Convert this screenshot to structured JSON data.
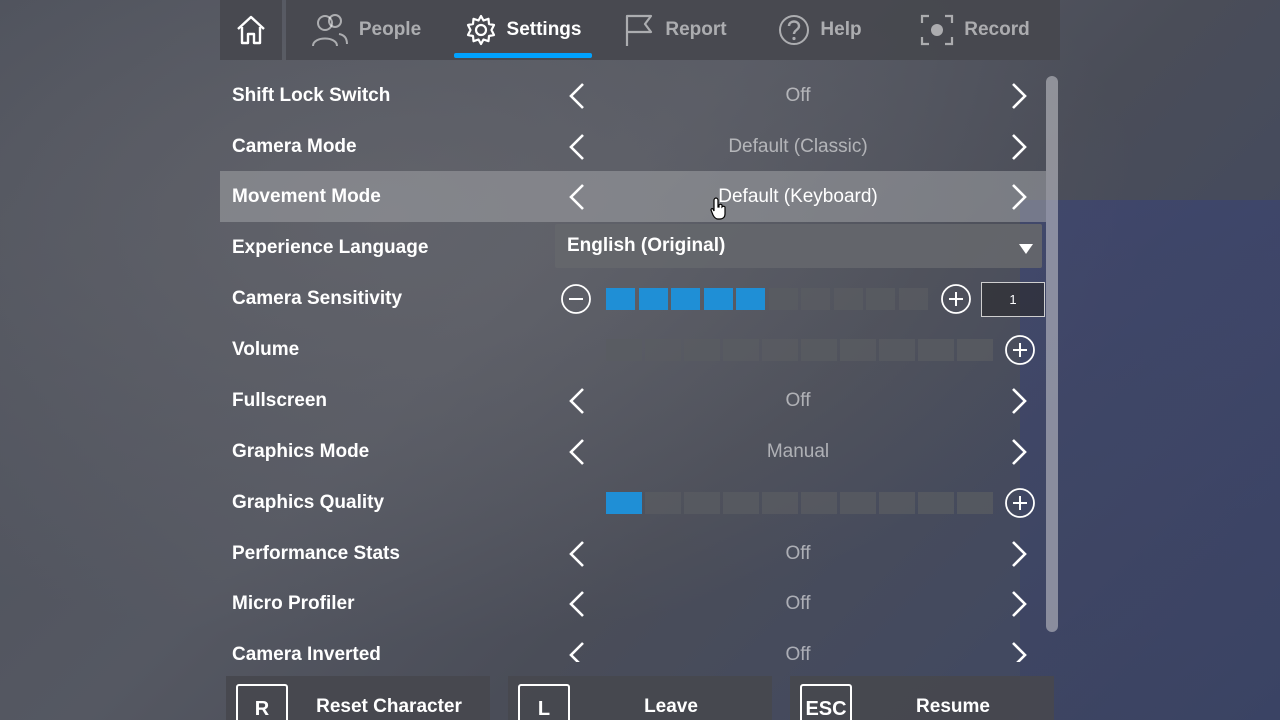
{
  "tabs": {
    "home": {
      "icon": "home-icon"
    },
    "items": [
      {
        "label": "People",
        "icon": "people-icon",
        "active": false
      },
      {
        "label": "Settings",
        "icon": "gear-icon",
        "active": true
      },
      {
        "label": "Report",
        "icon": "flag-icon",
        "active": false
      },
      {
        "label": "Help",
        "icon": "help-icon",
        "active": false
      },
      {
        "label": "Record",
        "icon": "record-icon",
        "active": false
      }
    ]
  },
  "settings": {
    "shift_lock": {
      "label": "Shift Lock Switch",
      "value": "Off"
    },
    "camera_mode": {
      "label": "Camera Mode",
      "value": "Default (Classic)"
    },
    "movement_mode": {
      "label": "Movement Mode",
      "value": "Default (Keyboard)"
    },
    "language": {
      "label": "Experience Language",
      "value": "English (Original)"
    },
    "camera_sensitivity": {
      "label": "Camera Sensitivity",
      "filled": 5,
      "total": 10,
      "value": "1"
    },
    "volume": {
      "label": "Volume",
      "filled": 0,
      "total": 10
    },
    "fullscreen": {
      "label": "Fullscreen",
      "value": "Off"
    },
    "graphics_mode": {
      "label": "Graphics Mode",
      "value": "Manual"
    },
    "graphics_quality": {
      "label": "Graphics Quality",
      "filled": 1,
      "total": 10
    },
    "performance_stats": {
      "label": "Performance Stats",
      "value": "Off"
    },
    "micro_profiler": {
      "label": "Micro Profiler",
      "value": "Off"
    },
    "camera_inverted": {
      "label": "Camera Inverted",
      "value": "Off"
    }
  },
  "bottom": {
    "reset": {
      "key": "R",
      "label": "Reset Character"
    },
    "leave": {
      "key": "L",
      "label": "Leave"
    },
    "resume": {
      "key": "ESC",
      "label": "Resume"
    }
  },
  "colors": {
    "accent": "#00a2ff",
    "slider_on": "#1f8fd6"
  }
}
